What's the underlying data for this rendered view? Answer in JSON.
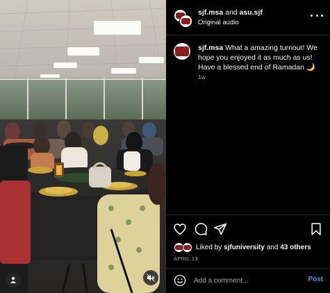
{
  "header": {
    "user1": "sjf.msa",
    "joiner": " and ",
    "user2": "asu.sjf",
    "audio": "Original audio"
  },
  "caption": {
    "username": "sjf.msa",
    "text": " What a amazing turnout! We hope you enjoyed it as much as us! Have a blessed end of Ramadan 🌙",
    "time": "1w"
  },
  "likes": {
    "prefix": "Liked by ",
    "user": "sjfuniversity",
    "middle": " and ",
    "others": "43 others"
  },
  "date": "APRIL 13",
  "comment": {
    "placeholder": "Add a comment...",
    "post_label": "Post"
  },
  "icons": {
    "tag": "user-tag-icon",
    "mute": "speaker-muted-icon",
    "like": "heart-icon",
    "comment": "comment-bubble-icon",
    "share": "paper-plane-icon",
    "save": "bookmark-icon",
    "emoji": "smiley-icon",
    "more": "more-horizontal-icon"
  },
  "colors": {
    "background": "#000000",
    "text": "#f5f5f5",
    "muted": "#a8a8a8",
    "link": "#4a9bd8",
    "divider": "#262626"
  }
}
